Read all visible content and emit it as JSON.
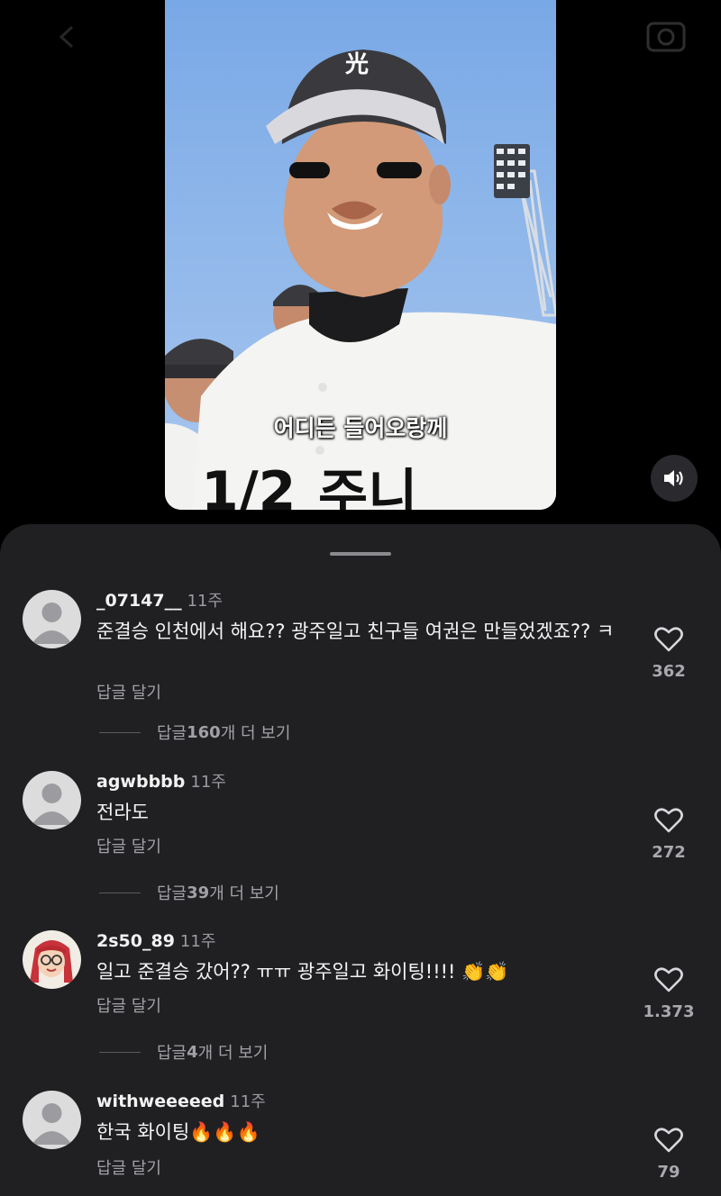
{
  "video": {
    "subtitle": "어디든 들어오랑께"
  },
  "comments": [
    {
      "username": "_07147__",
      "time": "11주",
      "text": "준결승 인천에서 해요?? 광주일고 친구들 여권은 만들었겠죠?? ㅋ",
      "reply_label": "답글 달기",
      "likes": "362",
      "more_replies": {
        "prefix": "답글 ",
        "count": "160",
        "suffix": "개 더 보기"
      }
    },
    {
      "username": "agwbbbb",
      "time": "11주",
      "text": "전라도",
      "reply_label": "답글 달기",
      "likes": "272",
      "more_replies": {
        "prefix": "답글 ",
        "count": "39",
        "suffix": "개 더 보기"
      }
    },
    {
      "username": "2s50_89",
      "time": "11주",
      "text": "일고 준결승 갔어?? ㅠㅠ 광주일고 화이팅!!!! 👏👏",
      "reply_label": "답글 달기",
      "likes": "1.373",
      "more_replies": {
        "prefix": "답글 ",
        "count": "4",
        "suffix": "개 더 보기"
      }
    },
    {
      "username": "withweeeeed",
      "time": "11주",
      "text": "한국 화이팅🔥🔥🔥",
      "reply_label": "답글 달기",
      "likes": "79"
    }
  ],
  "icons": {
    "sound": "speaker-icon",
    "like": "heart-outline-icon",
    "avatar_default": "default-avatar-icon"
  },
  "colors": {
    "sheet_bg": "#202023",
    "page_bg": "#000000",
    "muted_text": "#a1a1a6"
  }
}
